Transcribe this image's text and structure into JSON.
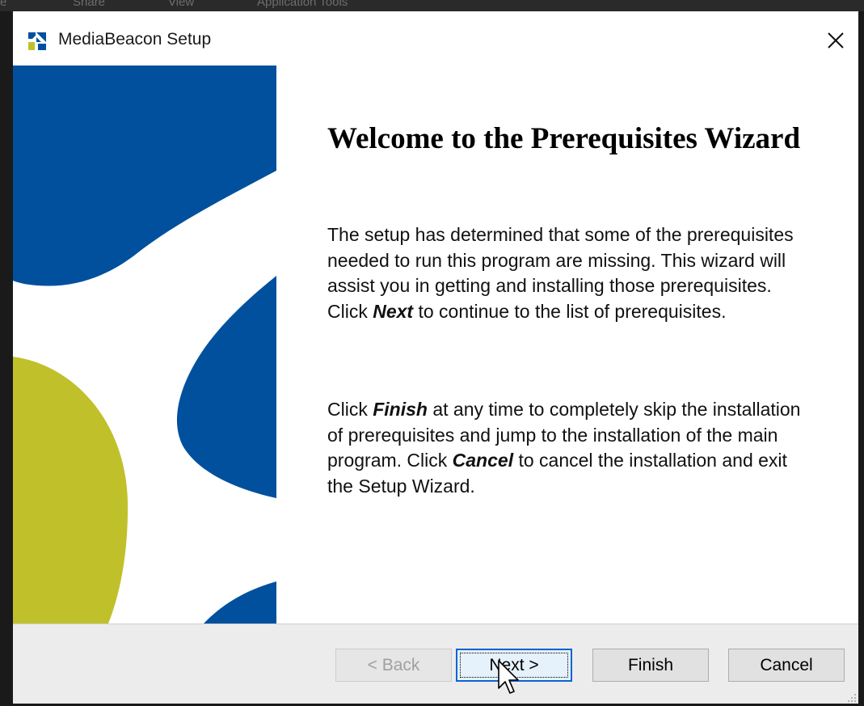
{
  "window": {
    "title": "MediaBeacon Setup",
    "close_glyph": "✕"
  },
  "welcome": {
    "heading": "Welcome to the Prerequisites Wizard",
    "para1_text": "The setup has determined that some of the prerequisites needed to run this program are missing. This wizard will assist you in getting and installing those prerequisites. Click ",
    "para1_bold": "Next",
    "para1_tail": "  to continue to the list of prerequisites.",
    "para2_a": "Click ",
    "para2_finish": "Finish",
    "para2_b": " at any time to completely skip the installation of prerequisites and jump to the installation of the main program. Click ",
    "para2_cancel": "Cancel",
    "para2_c": " to cancel the installation and exit the Setup Wizard."
  },
  "buttons": {
    "back": "< Back",
    "next": "Next >",
    "finish": "Finish",
    "cancel": "Cancel"
  },
  "background_menu": {
    "items": [
      "e",
      "Share",
      "View",
      "Application Tools"
    ]
  },
  "colors": {
    "brand_blue": "#00509e",
    "brand_olive": "#c0c12a",
    "focus_blue": "#0a64d0"
  }
}
